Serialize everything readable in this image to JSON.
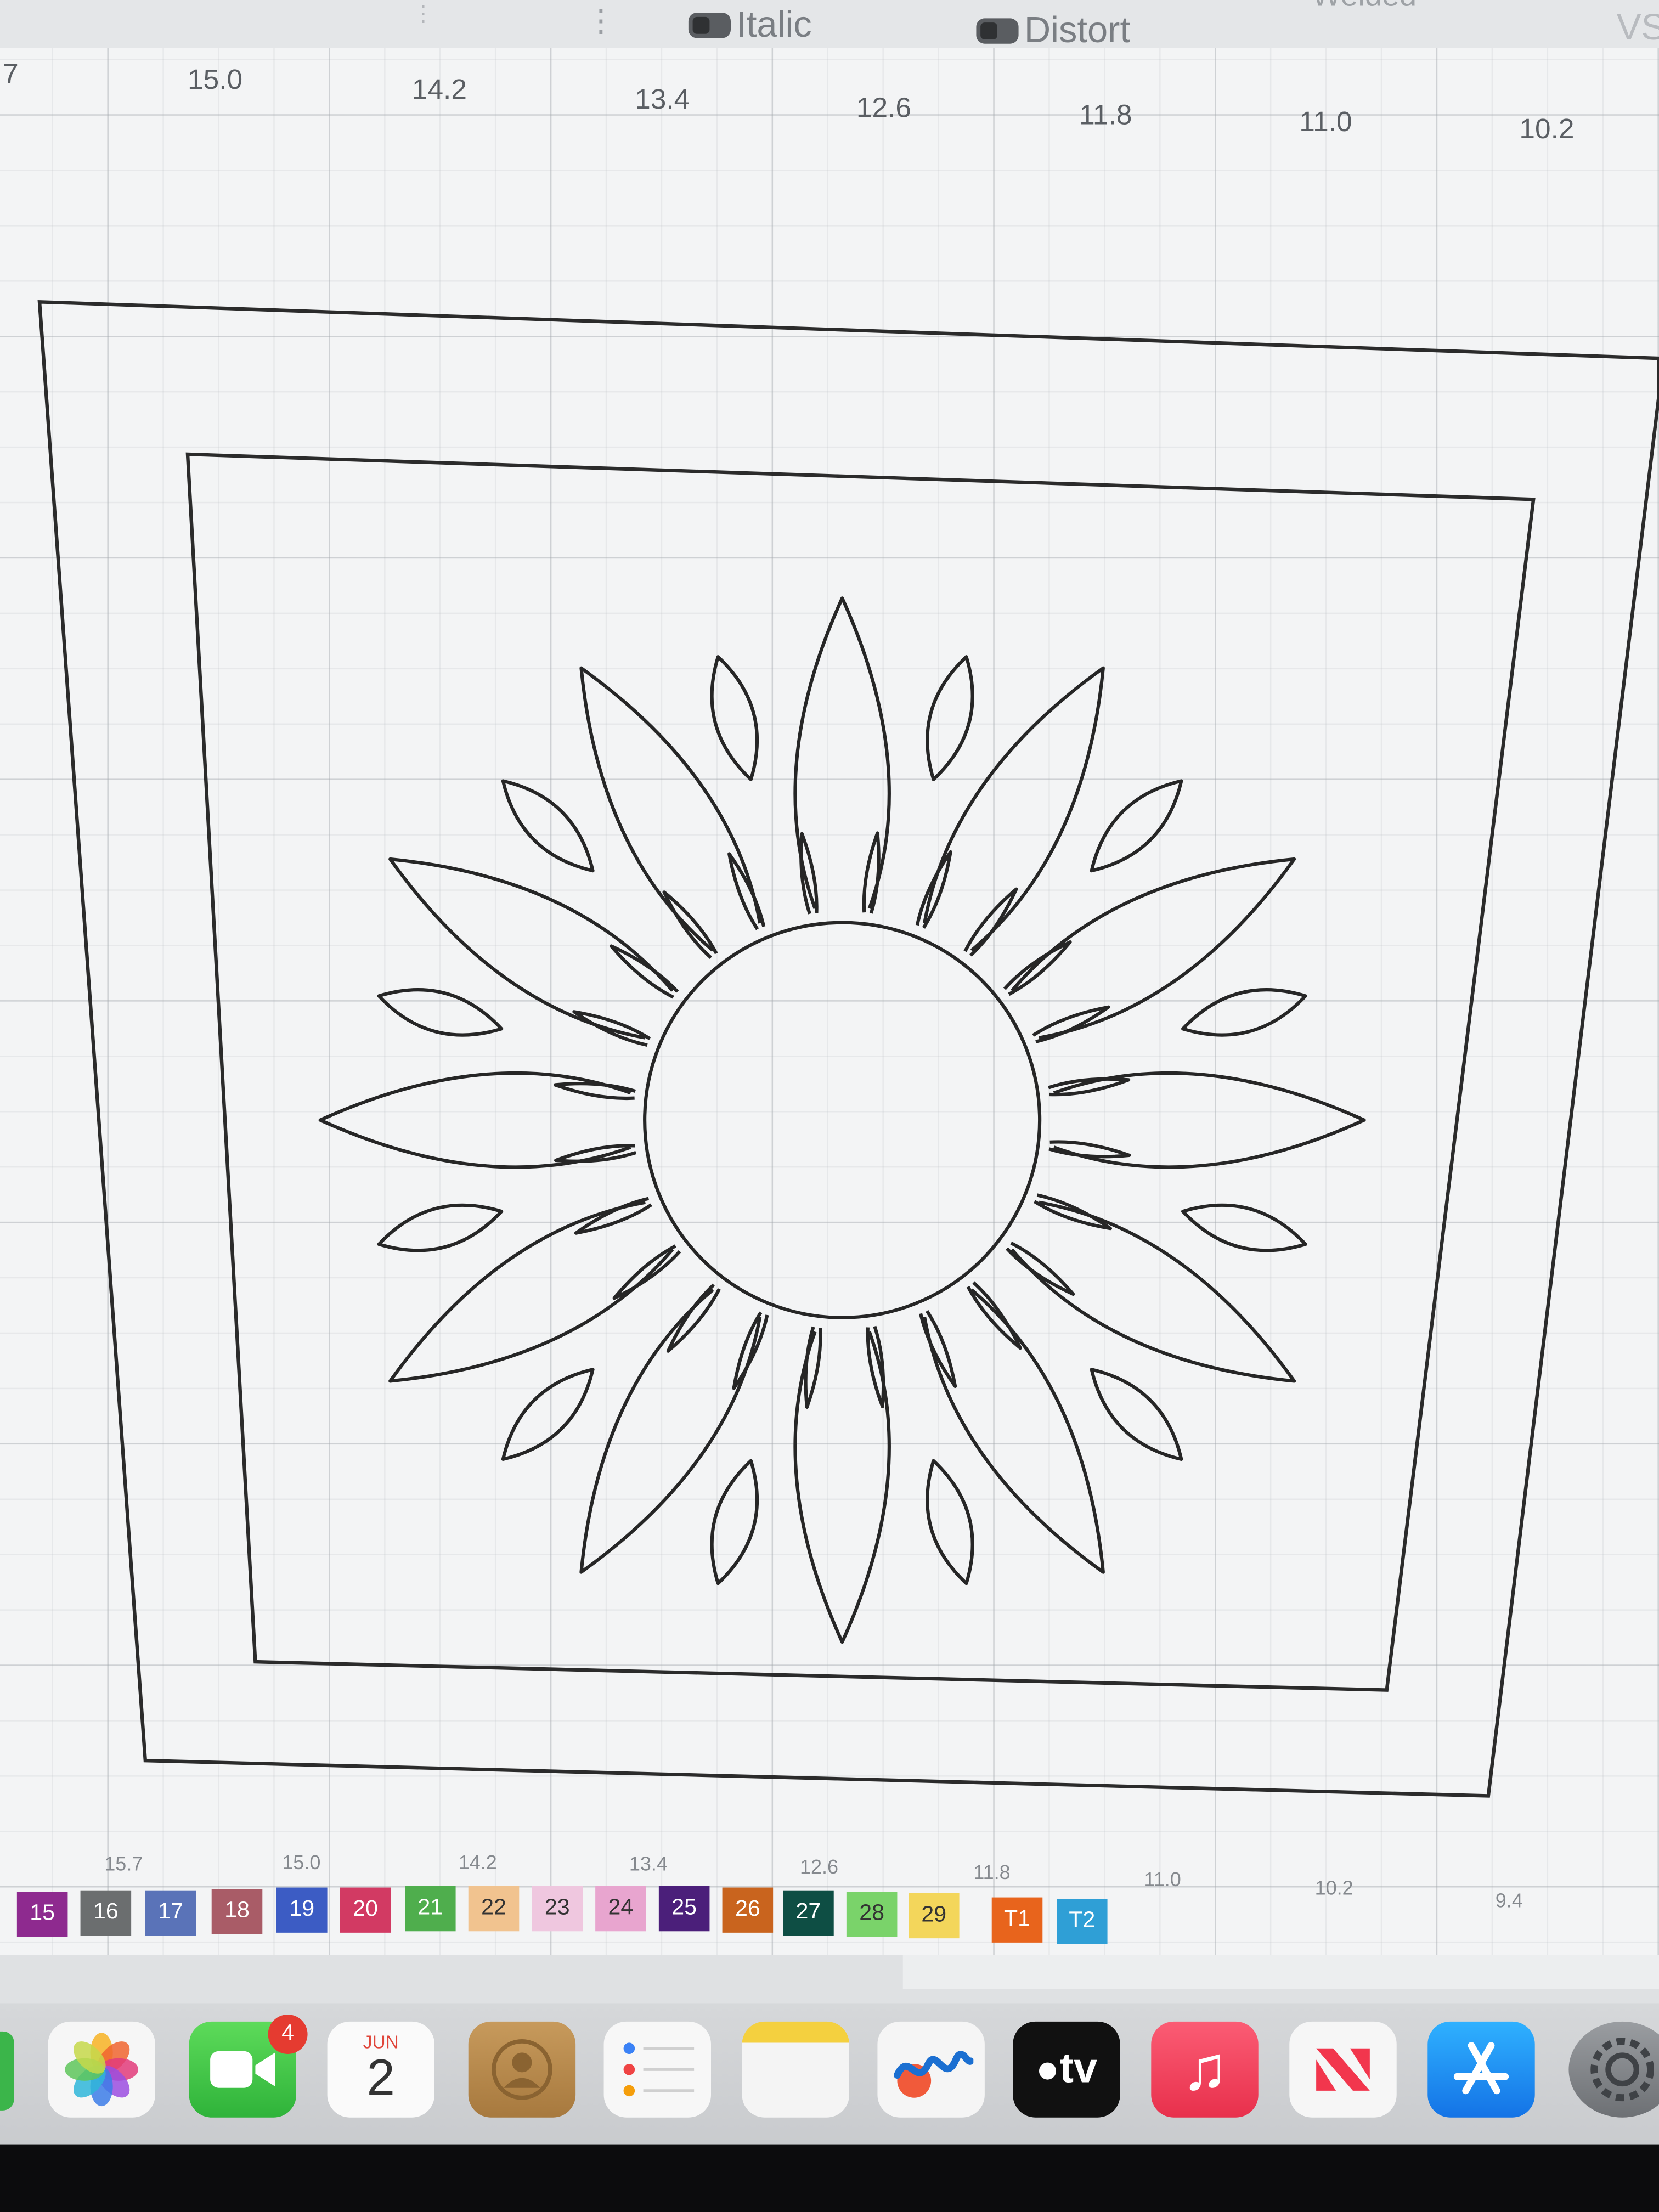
{
  "toolbar": {
    "italic_label": "Italic",
    "distort_label": "Distort",
    "welded_label": "Welded",
    "vs_label": "VS",
    "more_icon": "vertical-ellipsis-icon"
  },
  "ruler_top": {
    "left_edge": "7",
    "ticks": [
      "15.0",
      "14.2",
      "13.4",
      "12.6",
      "11.8",
      "11.0",
      "10.2"
    ]
  },
  "ruler_bottom": {
    "ticks": [
      "15.7",
      "15.0",
      "14.2",
      "13.4",
      "12.6",
      "11.8",
      "11.0",
      "10.2",
      "9.4"
    ]
  },
  "swatches": [
    {
      "label": "15",
      "color": "#8e2a8f"
    },
    {
      "label": "16",
      "color": "#6b6e6f"
    },
    {
      "label": "17",
      "color": "#5a73b8"
    },
    {
      "label": "18",
      "color": "#a95c67"
    },
    {
      "label": "19",
      "color": "#3c5cc4"
    },
    {
      "label": "20",
      "color": "#d23a63"
    },
    {
      "label": "21",
      "color": "#4fae4d"
    },
    {
      "label": "22",
      "color": "#f1c38f"
    },
    {
      "label": "23",
      "color": "#efc7df"
    },
    {
      "label": "24",
      "color": "#e8a5cf"
    },
    {
      "label": "25",
      "color": "#4b1f7a"
    },
    {
      "label": "26",
      "color": "#c9641e"
    },
    {
      "label": "27",
      "color": "#0e4e44"
    },
    {
      "label": "28",
      "color": "#7ad36a"
    },
    {
      "label": "29",
      "color": "#f3d65b"
    },
    {
      "label": "T1",
      "color": "#e8641c"
    },
    {
      "label": "T2",
      "color": "#2f9fd6"
    }
  ],
  "dock": {
    "facetime_badge": "4",
    "calendar_month": "JUN",
    "calendar_day": "2",
    "appletv_label": "tv",
    "apps": [
      "photos-icon",
      "facetime-icon",
      "calendar-icon",
      "contacts-icon",
      "reminders-icon",
      "notes-icon",
      "freeform-icon",
      "apple-tv-icon",
      "music-icon",
      "news-icon",
      "app-store-icon",
      "system-settings-icon"
    ]
  }
}
